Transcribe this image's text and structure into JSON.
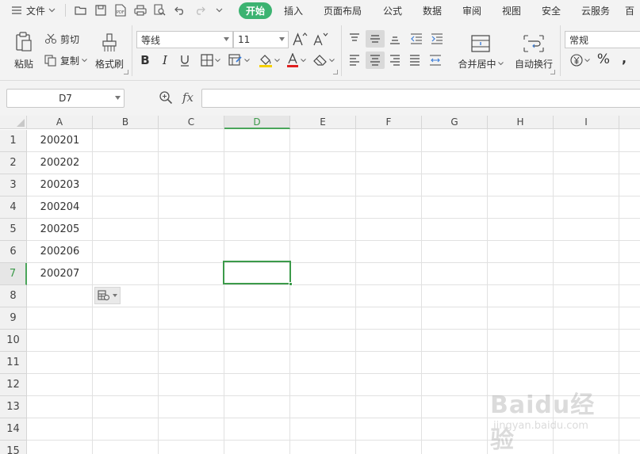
{
  "menu": {
    "file_label": "文件",
    "tabs": [
      "开始",
      "插入",
      "页面布局",
      "公式",
      "数据",
      "审阅",
      "视图",
      "安全",
      "云服务",
      "百"
    ]
  },
  "ribbon": {
    "paste": "粘贴",
    "cut": "剪切",
    "copy": "复制",
    "format_painter": "格式刷",
    "font_name": "等线",
    "font_size": "11",
    "merge_center": "合并居中",
    "wrap_text": "自动换行",
    "number_format": "常规",
    "percent": "%",
    "comma": ","
  },
  "formula_bar": {
    "name_box": "D7",
    "fx": "fx",
    "formula": ""
  },
  "sheet": {
    "columns": [
      "A",
      "B",
      "C",
      "D",
      "E",
      "F",
      "G",
      "H",
      "I"
    ],
    "rows": [
      "1",
      "2",
      "3",
      "4",
      "5",
      "6",
      "7",
      "8",
      "9",
      "10",
      "11",
      "12",
      "13",
      "14",
      "15"
    ],
    "selected_column": "D",
    "selected_row": "7",
    "column_a_values": [
      "200201",
      "200202",
      "200203",
      "200204",
      "200205",
      "200206",
      "200207"
    ]
  },
  "watermark": {
    "text": "Baidu经验",
    "url": "jingyan.baidu.com"
  },
  "colors": {
    "accent": "#3cb371",
    "selection": "#3c9a4a",
    "font_red": "#e02020",
    "highlight_yellow": "#f5d000"
  }
}
